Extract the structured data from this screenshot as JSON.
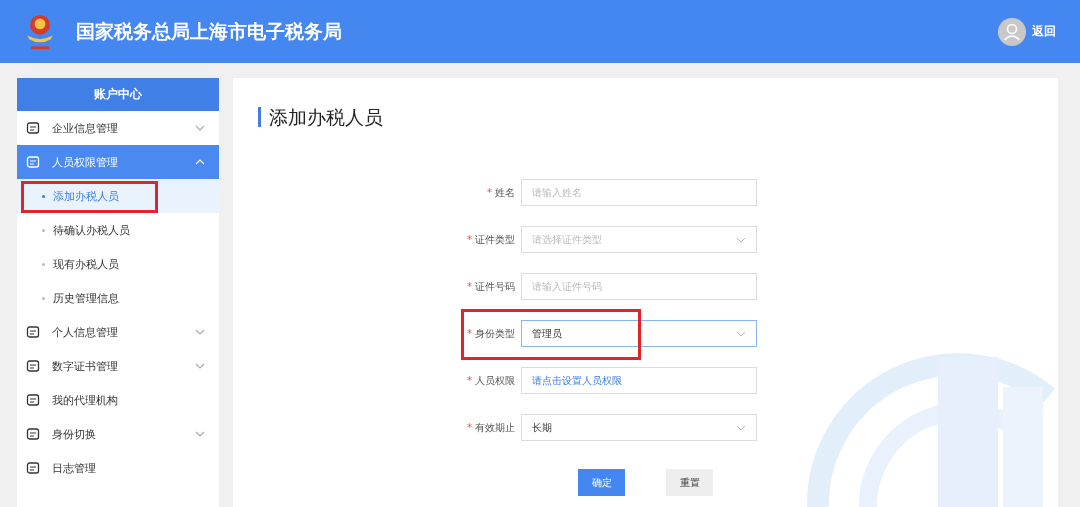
{
  "header": {
    "title": "国家税务总局上海市电子税务局",
    "back_link": "返回"
  },
  "sidebar": {
    "title": "账户中心",
    "items": [
      {
        "label": "企业信息管理",
        "expandable": true,
        "expanded": false
      },
      {
        "label": "人员权限管理",
        "expandable": true,
        "expanded": true,
        "children": [
          {
            "label": "添加办税人员",
            "selected": true,
            "highlighted": true
          },
          {
            "label": "待确认办税人员",
            "selected": false,
            "highlighted": false
          },
          {
            "label": "现有办税人员",
            "selected": false,
            "highlighted": false
          },
          {
            "label": "历史管理信息",
            "selected": false,
            "highlighted": false
          }
        ]
      },
      {
        "label": "个人信息管理",
        "expandable": true,
        "expanded": false
      },
      {
        "label": "数字证书管理",
        "expandable": true,
        "expanded": false
      },
      {
        "label": "我的代理机构",
        "expandable": false,
        "expanded": false
      },
      {
        "label": "身份切换",
        "expandable": true,
        "expanded": false
      },
      {
        "label": "日志管理",
        "expandable": false,
        "expanded": false
      }
    ]
  },
  "form": {
    "title": "添加办税人员",
    "fields": [
      {
        "label": "姓名",
        "marker": "*",
        "kind": "input",
        "placeholder": "请输入姓名",
        "focused": false,
        "highlighted": false
      },
      {
        "label": "证件类型",
        "marker": "*",
        "kind": "select",
        "placeholder": "请选择证件类型",
        "focused": false,
        "highlighted": false
      },
      {
        "label": "证件号码",
        "marker": "*",
        "kind": "input",
        "placeholder": "请输入证件号码",
        "focused": false,
        "highlighted": false
      },
      {
        "label": "身份类型",
        "marker": "*",
        "kind": "select",
        "value": "管理员",
        "focused": true,
        "highlighted": true
      },
      {
        "label": "人员权限",
        "marker": "*",
        "kind": "link",
        "value": "请点击设置人员权限",
        "focused": false,
        "highlighted": false
      },
      {
        "label": "有效期止",
        "marker": "*",
        "kind": "select",
        "value": "长期",
        "focused": false,
        "highlighted": false
      }
    ],
    "buttons": [
      {
        "label": "确定",
        "kind": "primary"
      },
      {
        "label": "重置",
        "kind": "secondary"
      }
    ]
  }
}
